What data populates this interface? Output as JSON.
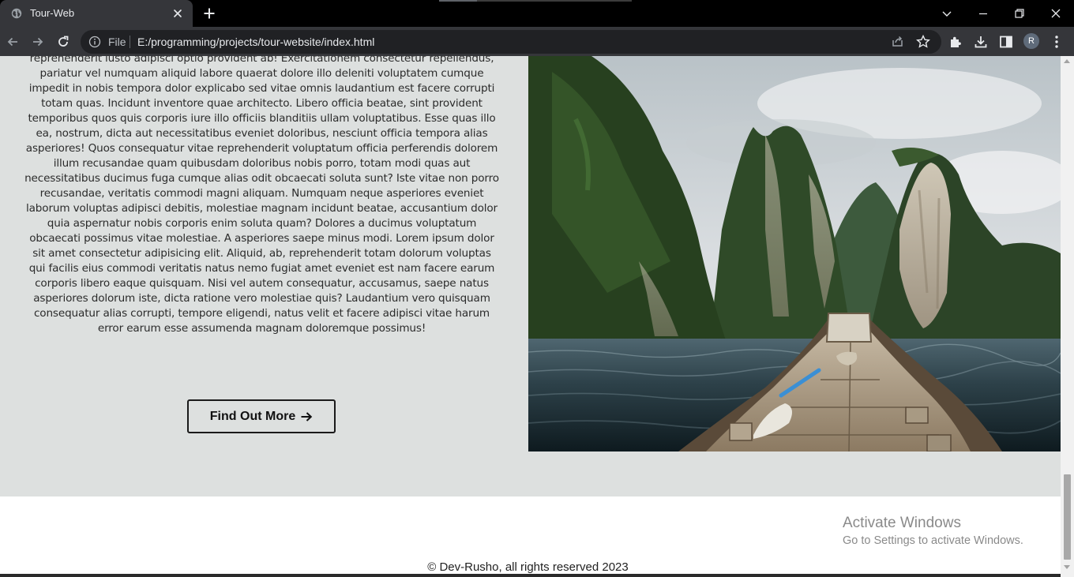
{
  "browser": {
    "tab_title": "Tour-Web",
    "omnibox_scheme": "File",
    "url": "E:/programming/projects/tour-website/index.html",
    "profile_initial": "R"
  },
  "page": {
    "about_text": "reprehenderit iusto adipisci optio provident ab! Exercitationem consectetur repellendus, pariatur vel numquam aliquid labore quaerat dolore illo deleniti voluptatem cumque impedit in nobis tempora dolor explicabo sed vitae omnis laudantium est facere corrupti totam quas. Incidunt inventore quae architecto. Libero officia beatae, sint provident temporibus quos quis corporis iure illo officiis blanditiis ullam voluptatibus. Esse quas illo ea, nostrum, dicta aut necessitatibus eveniet doloribus, nesciunt officia tempora alias asperiores! Quos consequatur vitae reprehenderit voluptatum officia perferendis dolorem illum recusandae quam quibusdam doloribus nobis porro, totam modi quas aut necessitatibus ducimus fuga cumque alias odit obcaecati soluta sunt? Iste vitae non porro recusandae, veritatis commodi magni aliquam. Numquam neque asperiores eveniet laborum voluptas adipisci debitis, molestiae magnam incidunt beatae, accusantium dolor quia aspernatur nobis corporis enim soluta quam? Dolores a ducimus voluptatum obcaecati possimus vitae molestiae. A asperiores saepe minus modi. Lorem ipsum dolor sit amet consectetur adipisicing elit. Aliquid, ab, reprehenderit totam dolorum voluptas qui facilis eius commodi veritatis natus nemo fugiat amet eveniet est nam facere earum corporis libero eaque quisquam. Nisi vel autem consequatur, accusamus, saepe natus asperiores dolorum iste, dicta ratione vero molestiae quis? Laudantium vero quisquam consequatur alias corrupti, tempore eligendi, natus velit et facere adipisci vitae harum error earum esse assumenda magnam doloremque possimus!",
    "cta_label": "Find Out More",
    "footer_text": "© Dev-Rusho, all rights reserved 2023"
  },
  "os_overlay": {
    "title": "Activate Windows",
    "subtitle": "Go to Settings to activate Windows."
  },
  "colors": {
    "page_background": "#dde0df",
    "footer_background": "#ffffff",
    "chrome_dark": "#35363a",
    "omnibox": "#202124"
  },
  "icons": [
    "globe-icon",
    "close-icon",
    "plus-icon",
    "chevron-down-icon",
    "minimize-icon",
    "restore-icon",
    "window-close-icon",
    "back-arrow-icon",
    "forward-arrow-icon",
    "reload-icon",
    "info-icon",
    "share-icon",
    "star-icon",
    "extensions-icon",
    "download-icon",
    "side-panel-icon",
    "menu-dots-icon",
    "arrow-right-icon"
  ]
}
